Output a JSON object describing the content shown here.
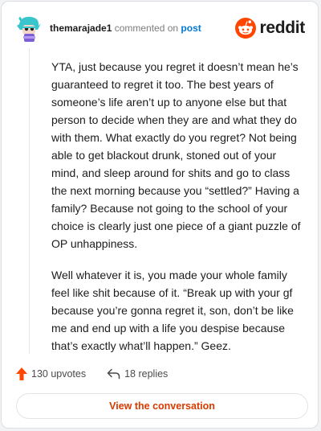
{
  "header": {
    "username": "themarajade1",
    "action_text": " commented on ",
    "post_link": "post",
    "brand_name": "reddit",
    "avatar_icon": "snoo-avatar-icon",
    "brand_icon": "reddit-logo-icon"
  },
  "comment": {
    "paragraphs": [
      "YTA, just because you regret it doesn’t mean he’s guaranteed to regret it too. The best years of someone’s life aren’t up to anyone else but that person to decide when they are and what they do with them. What exactly do you regret? Not being able to get blackout drunk, stoned out of your mind, and sleep around for shits and go to class the next morning because you “settled?” Having a family? Because not going to the school of your choice is clearly just one piece of a giant puzzle of OP unhappiness.",
      "Well whatever it is, you made your whole family feel like shit because of it. “Break up with your gf because you’re gonna regret it, son, don’t be like me and end up with a life you despise because that’s exactly what’ll happen.” Geez."
    ]
  },
  "footer": {
    "upvotes": "130 upvotes",
    "replies": "18 replies",
    "upvote_icon": "upvote-arrow-icon",
    "reply_icon": "reply-arrow-icon"
  },
  "cta": {
    "label": "View the conversation"
  },
  "colors": {
    "brand": "#ff4500",
    "cta_text": "#d93a00",
    "link": "#0079d3"
  }
}
